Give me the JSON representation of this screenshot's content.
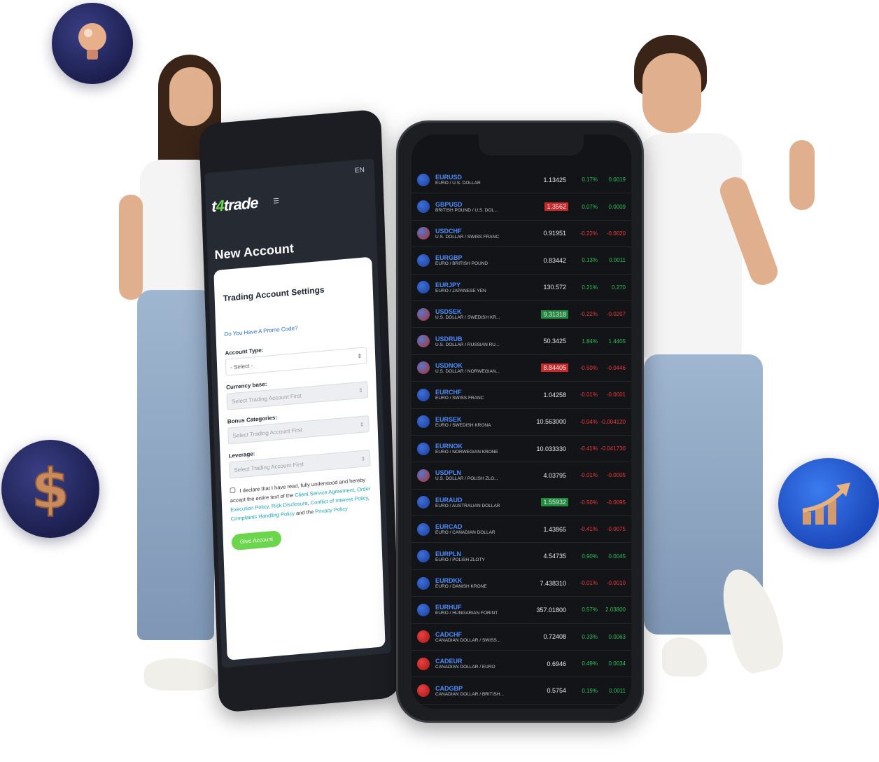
{
  "left_app": {
    "lang": "EN",
    "brand_prefix": "t",
    "brand_accent": "4",
    "brand_suffix": "trade",
    "title": "New Account",
    "section_title": "Trading Account Settings",
    "promo_link": "Do You Have A Promo Code?",
    "account_type_label": "Account Type:",
    "account_type_value": "- Select -",
    "currency_label": "Currency base:",
    "currency_value": "Select Trading Account First",
    "bonus_label": "Bonus Categories:",
    "bonus_value": "Select Trading Account First",
    "leverage_label": "Leverage:",
    "leverage_value": "Select Trading Account First",
    "agree_text": "I declare that I have read, fully understood and hereby accept the entire text of the",
    "agree_links": [
      "Client Service Agreement",
      "Order Execution Policy",
      "Risk Disclosure",
      "Conflict of Interest Policy",
      "Complaints Handling Policy"
    ],
    "agree_and": "and the",
    "privacy_link": "Privacy Policy",
    "give_button": "Give Account",
    "colors": {
      "accent": "#6bd64b",
      "link": "#2a6bd8"
    }
  },
  "quotes": [
    {
      "sym": "EURUSD",
      "name": "EURO / U.S. DOLLAR",
      "price": "1.13425",
      "chg": "0.17%",
      "abs": "0.0019",
      "dir": "pos",
      "flag": "eu",
      "hl": ""
    },
    {
      "sym": "GBPUSD",
      "name": "BRITISH POUND / U.S. DOL...",
      "price": "1.3562",
      "chg": "0.07%",
      "abs": "0.0009",
      "dir": "pos",
      "flag": "eu",
      "hl": "red"
    },
    {
      "sym": "USDCHF",
      "name": "U.S. DOLLAR / SWISS FRANC",
      "price": "0.91951",
      "chg": "-0.22%",
      "abs": "-0.0020",
      "dir": "neg",
      "flag": "us",
      "hl": ""
    },
    {
      "sym": "EURGBP",
      "name": "EURO / BRITISH POUND",
      "price": "0.83442",
      "chg": "0.13%",
      "abs": "0.0011",
      "dir": "pos",
      "flag": "eu",
      "hl": ""
    },
    {
      "sym": "EURJPY",
      "name": "EURO / JAPANESE YEN",
      "price": "130.572",
      "chg": "0.21%",
      "abs": "0.270",
      "dir": "pos",
      "flag": "eu",
      "hl": ""
    },
    {
      "sym": "USDSEK",
      "name": "U.S. DOLLAR / SWEDISH KR...",
      "price": "9.31318",
      "chg": "-0.22%",
      "abs": "-0.0207",
      "dir": "neg",
      "flag": "us",
      "hl": "green"
    },
    {
      "sym": "USDRUB",
      "name": "U.S. DOLLAR / RUSSIAN RU...",
      "price": "50.3425",
      "chg": "1.84%",
      "abs": "1.4405",
      "dir": "pos",
      "flag": "us",
      "hl": ""
    },
    {
      "sym": "USDNOK",
      "name": "U.S. DOLLAR / NORWEGIAN...",
      "price": "8.84405",
      "chg": "-0.50%",
      "abs": "-0.0446",
      "dir": "neg",
      "flag": "us",
      "hl": "red"
    },
    {
      "sym": "EURCHF",
      "name": "EURO / SWISS FRANC",
      "price": "1.04258",
      "chg": "-0.01%",
      "abs": "-0.0001",
      "dir": "neg",
      "flag": "eu",
      "hl": ""
    },
    {
      "sym": "EURSEK",
      "name": "EURO / SWEDISH KRONA",
      "price": "10.563000",
      "chg": "-0.04%",
      "abs": "-0.004120",
      "dir": "neg",
      "flag": "eu",
      "hl": ""
    },
    {
      "sym": "EURNOK",
      "name": "EURO / NORWEGIAN KRONE",
      "price": "10.033330",
      "chg": "-0.41%",
      "abs": "-0.041730",
      "dir": "neg",
      "flag": "eu",
      "hl": ""
    },
    {
      "sym": "USDPLN",
      "name": "U.S. DOLLAR / POLISH ZLO...",
      "price": "4.03795",
      "chg": "-0.01%",
      "abs": "-0.0005",
      "dir": "neg",
      "flag": "us",
      "hl": ""
    },
    {
      "sym": "EURAUD",
      "name": "EURO / AUSTRALIAN DOLLAR",
      "price": "1.55932",
      "chg": "-0.50%",
      "abs": "-0.0095",
      "dir": "neg",
      "flag": "eu",
      "hl": "green"
    },
    {
      "sym": "EURCAD",
      "name": "EURO / CANADIAN DOLLAR",
      "price": "1.43865",
      "chg": "-0.41%",
      "abs": "-0.0075",
      "dir": "neg",
      "flag": "eu",
      "hl": ""
    },
    {
      "sym": "EURPLN",
      "name": "EURO / POLISH ZLOTY",
      "price": "4.54735",
      "chg": "0.90%",
      "abs": "0.0045",
      "dir": "pos",
      "flag": "eu",
      "hl": ""
    },
    {
      "sym": "EURDKK",
      "name": "EURO / DANISH KRONE",
      "price": "7.438310",
      "chg": "-0.01%",
      "abs": "-0.0010",
      "dir": "neg",
      "flag": "eu",
      "hl": ""
    },
    {
      "sym": "EURHUF",
      "name": "EURO / HUNGARIAN FORINT",
      "price": "357.01800",
      "chg": "0.57%",
      "abs": "2.03800",
      "dir": "pos",
      "flag": "eu",
      "hl": ""
    },
    {
      "sym": "CADCHF",
      "name": "CANADIAN DOLLAR / SWISS...",
      "price": "0.72408",
      "chg": "0.33%",
      "abs": "0.0063",
      "dir": "pos",
      "flag": "ca",
      "hl": ""
    },
    {
      "sym": "CADEUR",
      "name": "CANADIAN DOLLAR / EURO",
      "price": "0.6946",
      "chg": "0.49%",
      "abs": "0.0034",
      "dir": "pos",
      "flag": "ca",
      "hl": ""
    },
    {
      "sym": "CADGBP",
      "name": "CANADIAN DOLLAR / BRITISH...",
      "price": "0.5754",
      "chg": "0.19%",
      "abs": "0.0011",
      "dir": "pos",
      "flag": "ca",
      "hl": ""
    }
  ],
  "icons": [
    "lightbulb-icon",
    "dollar-icon",
    "growth-chart-icon"
  ]
}
